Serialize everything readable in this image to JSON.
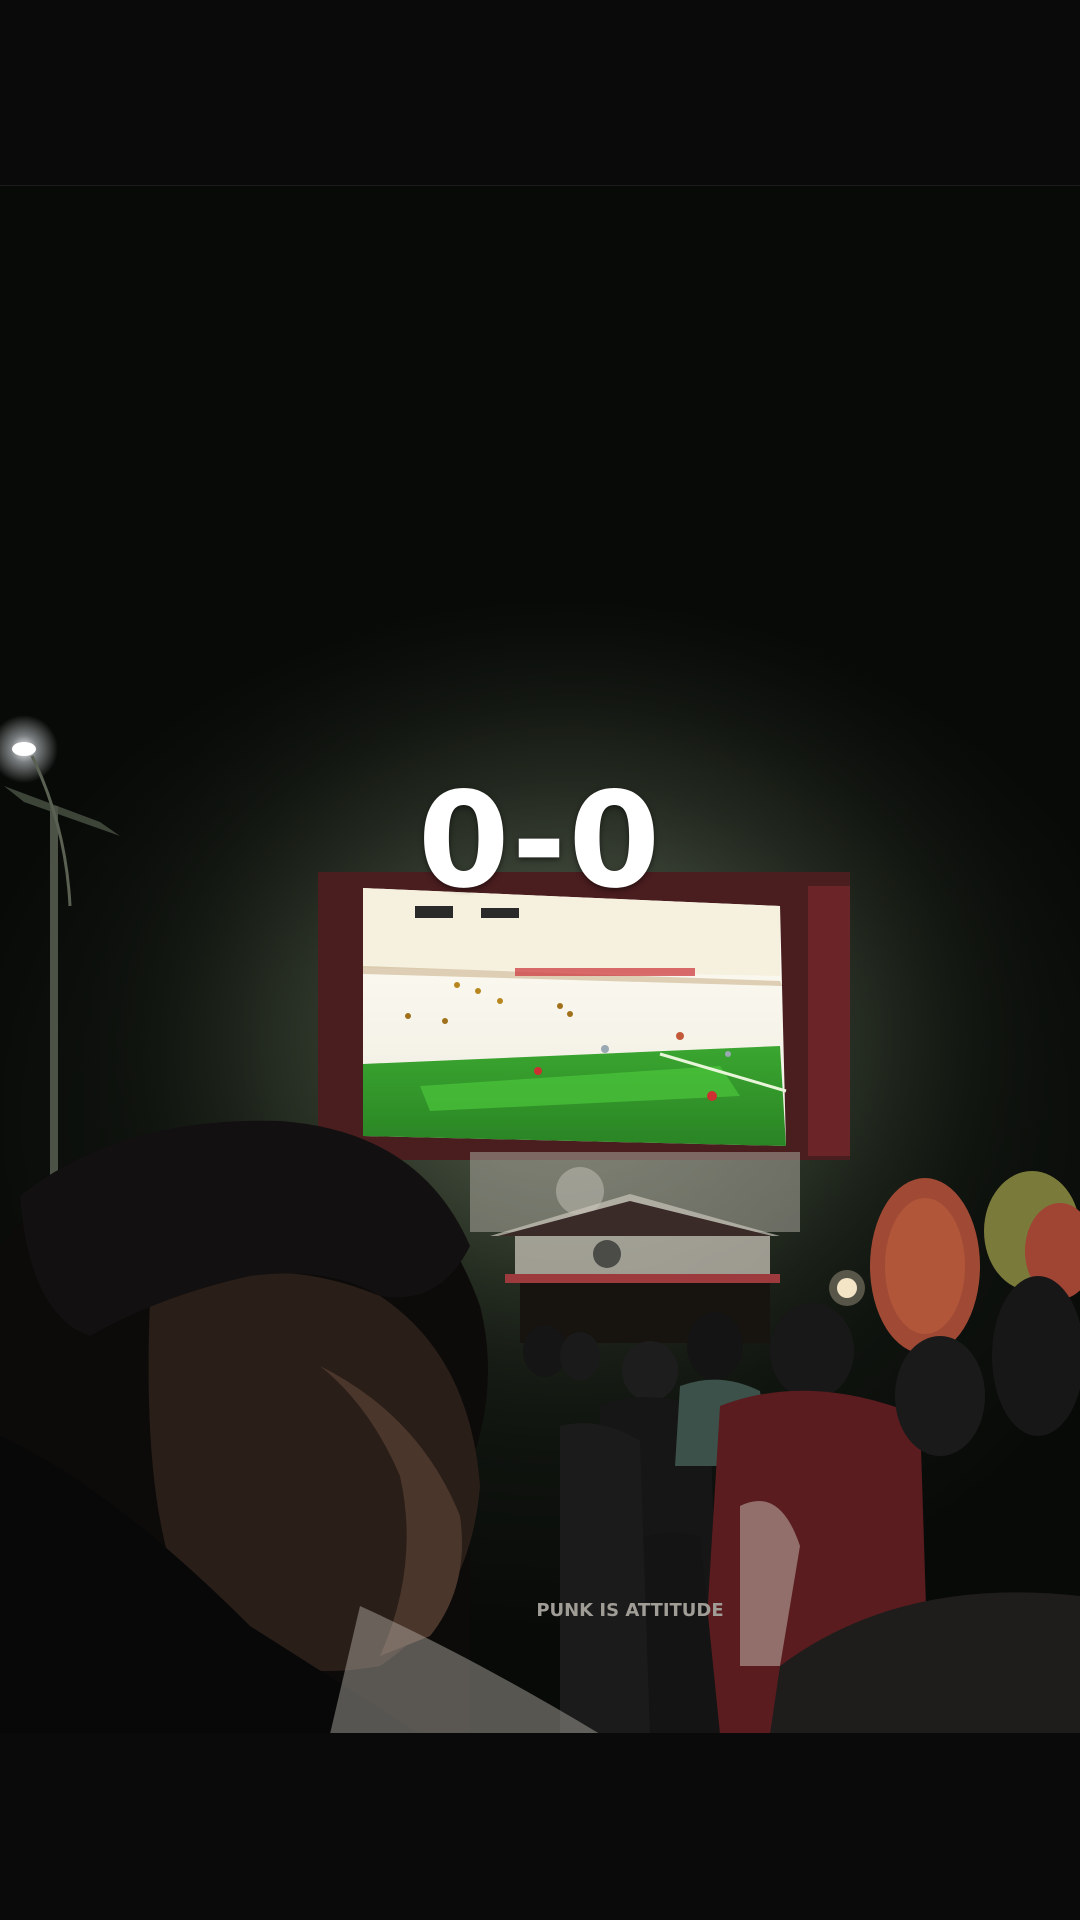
{
  "overlay": {
    "score_text": "0-0"
  },
  "colors": {
    "background": "#080808",
    "overlay_text": "#ffffff",
    "screen_glow": "#f3f1e6",
    "pitch_green": "#2f8f2a"
  },
  "scene": {
    "jumbotron_shirt_text": "PUNK IS ATTITUDE"
  }
}
